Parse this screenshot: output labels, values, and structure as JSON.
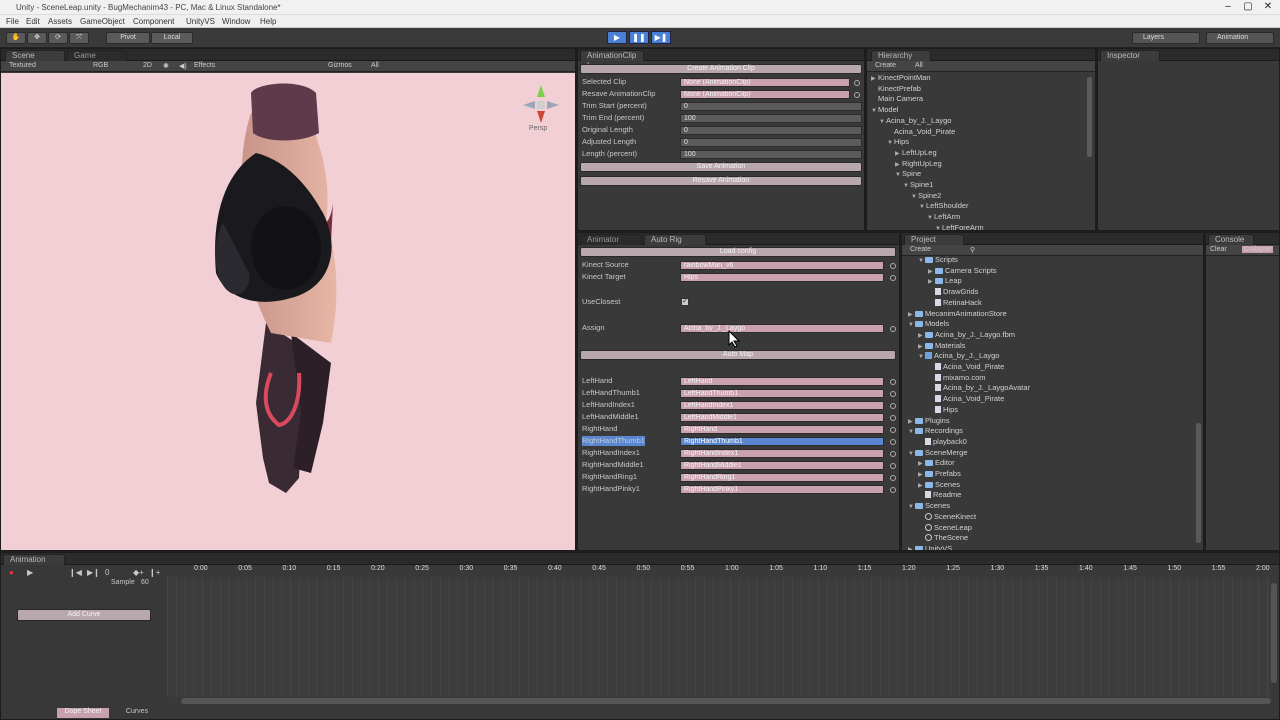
{
  "titlebar": {
    "title": "Unity - SceneLeap.unity - BugMechanim43 - PC, Mac & Linux Standalone*",
    "minimize": "–",
    "maximize": "▢",
    "close": "✕"
  },
  "menu": [
    "File",
    "Edit",
    "Assets",
    "GameObject",
    "Component",
    "UnityVS",
    "Window",
    "Help"
  ],
  "toolbar": {
    "pivot": "Pivot",
    "local": "Local",
    "layers": "Layers",
    "layout": "Animation"
  },
  "scene": {
    "tab_scene": "Scene",
    "tab_game": "Game",
    "shading": "Textured",
    "rgb": "RGB",
    "mode2d": "2D",
    "effects": "Effects",
    "gizmos": "Gizmos",
    "search": "All",
    "persp": "Persp",
    "bg_color": "#f2cfd4"
  },
  "animclip": {
    "tab": "AnimationClip I",
    "create_btn": "Create Animation Clip",
    "rows": [
      {
        "label": "Selected Clip",
        "value": "None (AnimationClip)"
      },
      {
        "label": "Resave AnimationClip",
        "value": "None (AnimationClip)"
      },
      {
        "label": "Trim Start (percent)",
        "value": "0"
      },
      {
        "label": "Trim End (percent)",
        "value": "100"
      },
      {
        "label": "Original Length",
        "value": "0"
      },
      {
        "label": "Adjusted Length",
        "value": "0"
      },
      {
        "label": "Length (percent)",
        "value": "100"
      }
    ],
    "save_btn": "Save Animation",
    "resave_btn": "Resave Animation"
  },
  "hierarchy": {
    "tab": "Hierarchy",
    "create": "Create",
    "search": "All",
    "items": [
      {
        "text": "KinectPointMan",
        "indent": 0,
        "arrow": "▶"
      },
      {
        "text": "KinectPrefab",
        "indent": 0,
        "arrow": ""
      },
      {
        "text": "Main Camera",
        "indent": 0,
        "arrow": ""
      },
      {
        "text": "Model",
        "indent": 0,
        "arrow": "▼"
      },
      {
        "text": "Acina_by_J._Laygo",
        "indent": 1,
        "arrow": "▼"
      },
      {
        "text": "Acina_Void_Pirate",
        "indent": 2,
        "arrow": ""
      },
      {
        "text": "Hips",
        "indent": 2,
        "arrow": "▼"
      },
      {
        "text": "LeftUpLeg",
        "indent": 3,
        "arrow": "▶"
      },
      {
        "text": "RightUpLeg",
        "indent": 3,
        "arrow": "▶"
      },
      {
        "text": "Spine",
        "indent": 3,
        "arrow": "▼"
      },
      {
        "text": "Spine1",
        "indent": 4,
        "arrow": "▼"
      },
      {
        "text": "Spine2",
        "indent": 5,
        "arrow": "▼"
      },
      {
        "text": "LeftShoulder",
        "indent": 6,
        "arrow": "▼"
      },
      {
        "text": "LeftArm",
        "indent": 7,
        "arrow": "▼"
      },
      {
        "text": "LeftForeArm",
        "indent": 8,
        "arrow": "▼"
      }
    ]
  },
  "inspector": {
    "tab": "Inspector"
  },
  "animator": {
    "tab_animator": "Animator",
    "tab_autorig": "Auto Rig",
    "load_btn": "Load config",
    "kinect_source_label": "Kinect Source",
    "kinect_source": "rainbowMan_v6",
    "kinect_target_label": "Kinect Target",
    "kinect_target": "Hips",
    "use_closest_label": "UseClosest",
    "assign_label": "Assign",
    "assign_value": "Acina_by_J._Laygo",
    "automap_btn": "Auto Map",
    "bones": [
      {
        "label": "LeftHand",
        "value": "LeftHand",
        "selected": false
      },
      {
        "label": "LeftHandThumb1",
        "value": "LeftHandThumb1",
        "selected": false
      },
      {
        "label": "LeftHandIndex1",
        "value": "LeftHandIndex1",
        "selected": false
      },
      {
        "label": "LeftHandMiddle1",
        "value": "LeftHandMiddle1",
        "selected": false
      },
      {
        "label": "RightHand",
        "value": "RightHand",
        "selected": false
      },
      {
        "label": "RightHandThumb1",
        "value": "RightHandThumb1",
        "selected": true
      },
      {
        "label": "RightHandIndex1",
        "value": "RightHandIndex1",
        "selected": false
      },
      {
        "label": "RightHandMiddle1",
        "value": "RightHandMiddle1",
        "selected": false
      },
      {
        "label": "RightHandRing1",
        "value": "RightHandRing1",
        "selected": false
      },
      {
        "label": "RightHandPinky1",
        "value": "RightHandPinky1",
        "selected": false
      }
    ]
  },
  "project": {
    "tab": "Project",
    "create": "Create",
    "items": [
      {
        "text": "Scripts",
        "indent": 1,
        "arrow": "▼",
        "icon": "folder"
      },
      {
        "text": "Camera Scripts",
        "indent": 2,
        "arrow": "▶",
        "icon": "folder"
      },
      {
        "text": "Leap",
        "indent": 2,
        "arrow": "▶",
        "icon": "folder"
      },
      {
        "text": "DrawGrids",
        "indent": 2,
        "arrow": "",
        "icon": "file"
      },
      {
        "text": "RetinaHack",
        "indent": 2,
        "arrow": "",
        "icon": "file"
      },
      {
        "text": "MecanimAnimationStore",
        "indent": 0,
        "arrow": "▶",
        "icon": "folder"
      },
      {
        "text": "Models",
        "indent": 0,
        "arrow": "▼",
        "icon": "folder"
      },
      {
        "text": "Acina_by_J._Laygo.fbm",
        "indent": 1,
        "arrow": "▶",
        "icon": "folder"
      },
      {
        "text": "Materials",
        "indent": 1,
        "arrow": "▶",
        "icon": "folder"
      },
      {
        "text": "Acina_by_J._Laygo",
        "indent": 1,
        "arrow": "▼",
        "icon": "cube"
      },
      {
        "text": "Acina_Void_Pirate",
        "indent": 2,
        "arrow": "",
        "icon": "file"
      },
      {
        "text": "mixamo.com",
        "indent": 2,
        "arrow": "",
        "icon": "file"
      },
      {
        "text": "Acina_by_J._LaygoAvatar",
        "indent": 2,
        "arrow": "",
        "icon": "file"
      },
      {
        "text": "Acina_Void_Pirate",
        "indent": 2,
        "arrow": "",
        "icon": "file"
      },
      {
        "text": "Hips",
        "indent": 2,
        "arrow": "",
        "icon": "file"
      },
      {
        "text": "Plugins",
        "indent": 0,
        "arrow": "▶",
        "icon": "folder"
      },
      {
        "text": "Recordings",
        "indent": 0,
        "arrow": "▼",
        "icon": "folder"
      },
      {
        "text": "playback0",
        "indent": 1,
        "arrow": "",
        "icon": "file"
      },
      {
        "text": "SceneMerge",
        "indent": 0,
        "arrow": "▼",
        "icon": "folder"
      },
      {
        "text": "Editor",
        "indent": 1,
        "arrow": "▶",
        "icon": "folder"
      },
      {
        "text": "Prefabs",
        "indent": 1,
        "arrow": "▶",
        "icon": "folder"
      },
      {
        "text": "Scenes",
        "indent": 1,
        "arrow": "▶",
        "icon": "folder"
      },
      {
        "text": "Readme",
        "indent": 1,
        "arrow": "",
        "icon": "file"
      },
      {
        "text": "Scenes",
        "indent": 0,
        "arrow": "▼",
        "icon": "folder"
      },
      {
        "text": "SceneKinect",
        "indent": 1,
        "arrow": "",
        "icon": "unity"
      },
      {
        "text": "SceneLeap",
        "indent": 1,
        "arrow": "",
        "icon": "unity"
      },
      {
        "text": "TheScene",
        "indent": 1,
        "arrow": "",
        "icon": "unity"
      },
      {
        "text": "UnityVS",
        "indent": 0,
        "arrow": "▶",
        "icon": "folder"
      }
    ]
  },
  "console": {
    "tab": "Console",
    "clear": "Clear",
    "collapse": "Collapse"
  },
  "animation": {
    "tab": "Animation",
    "frame": "0",
    "sample_label": "Sample",
    "sample": "60",
    "add_curve": "Add Curve",
    "dope_sheet": "Dope Sheet",
    "curves": "Curves",
    "ticks": [
      "0:00",
      "0:05",
      "0:10",
      "0:15",
      "0:20",
      "0:25",
      "0:30",
      "0:35",
      "0:40",
      "0:45",
      "0:50",
      "0:55",
      "1:00",
      "1:05",
      "1:10",
      "1:15",
      "1:20",
      "1:25",
      "1:30",
      "1:35",
      "1:40",
      "1:45",
      "1:50",
      "1:55",
      "2:00"
    ]
  }
}
